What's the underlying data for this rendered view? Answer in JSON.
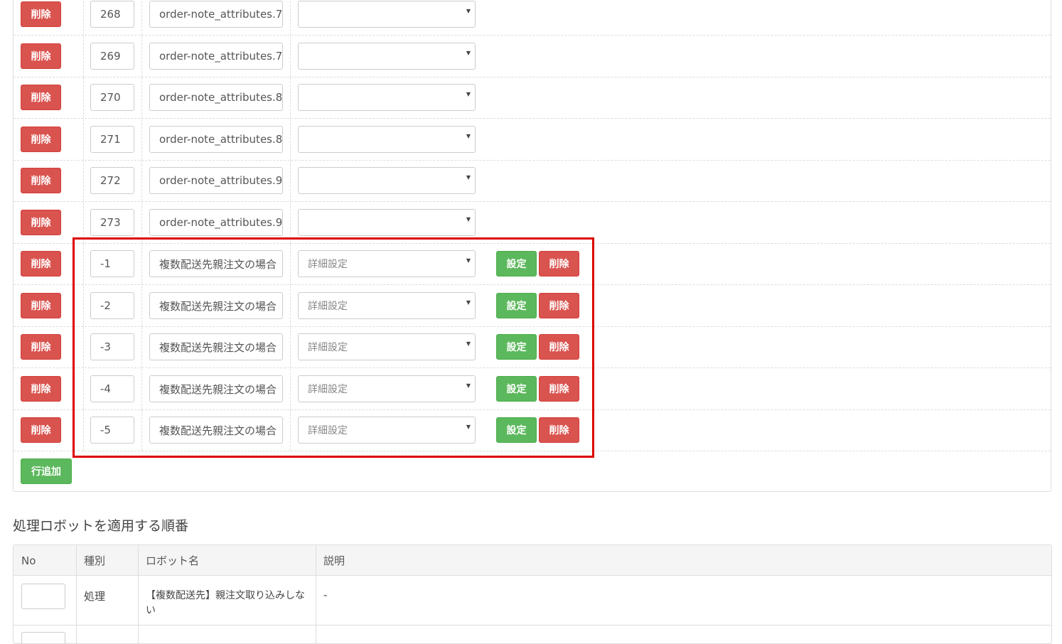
{
  "mapping_rows": [
    {
      "num": "268",
      "field": "order-note_attributes.7",
      "select": "",
      "has_actions": false
    },
    {
      "num": "269",
      "field": "order-note_attributes.7",
      "select": "",
      "has_actions": false
    },
    {
      "num": "270",
      "field": "order-note_attributes.8",
      "select": "",
      "has_actions": false
    },
    {
      "num": "271",
      "field": "order-note_attributes.8",
      "select": "",
      "has_actions": false
    },
    {
      "num": "272",
      "field": "order-note_attributes.9",
      "select": "",
      "has_actions": false
    },
    {
      "num": "273",
      "field": "order-note_attributes.9",
      "select": "",
      "has_actions": false
    },
    {
      "num": "-1",
      "field": "複数配送先親注文の場合",
      "select": "詳細設定",
      "has_actions": true
    },
    {
      "num": "-2",
      "field": "複数配送先親注文の場合",
      "select": "詳細設定",
      "has_actions": true
    },
    {
      "num": "-3",
      "field": "複数配送先親注文の場合",
      "select": "詳細設定",
      "has_actions": true
    },
    {
      "num": "-4",
      "field": "複数配送先親注文の場合",
      "select": "詳細設定",
      "has_actions": true
    },
    {
      "num": "-5",
      "field": "複数配送先親注文の場合",
      "select": "詳細設定",
      "has_actions": true
    }
  ],
  "labels": {
    "delete": "削除",
    "settings": "設定",
    "add_row": "行追加"
  },
  "robot_section": {
    "title": "処理ロボットを適用する順番",
    "headers": [
      "No",
      "種別",
      "ロボット名",
      "説明"
    ],
    "rows": [
      {
        "no": "",
        "type": "処理",
        "robot_name": "【複数配送先】親注文取り込みしない",
        "description": "-"
      }
    ]
  },
  "colors": {
    "danger": "#d9534f",
    "success": "#5cb85c",
    "highlight_border": "#dd0000"
  },
  "icons": {
    "select_caret": "caret-down-icon"
  }
}
